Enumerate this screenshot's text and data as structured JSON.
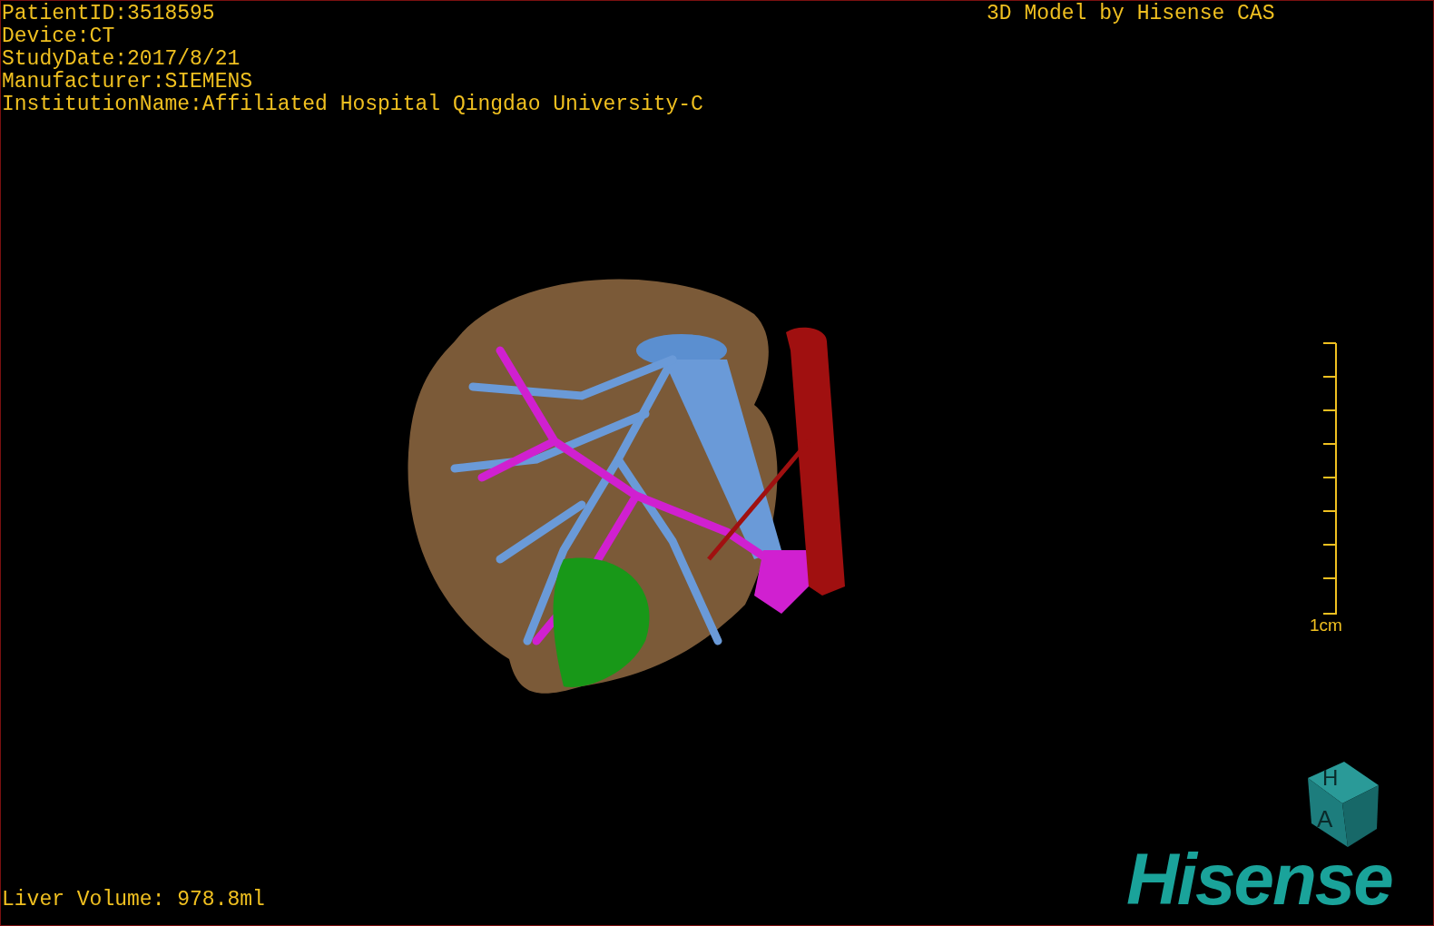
{
  "patient_info": [
    "PatientID:3518595",
    "Device:CT",
    "StudyDate:2017/8/21",
    "Manufacturer:SIEMENS",
    "InstitutionName:Affiliated Hospital Qingdao University-C"
  ],
  "title": "3D Model by Hisense CAS",
  "scale_bar": {
    "label": "1cm"
  },
  "orientation_cube": {
    "labels": [
      "H",
      "A"
    ]
  },
  "logo": "Hisense",
  "liver_volume": "Liver Volume: 978.8ml"
}
